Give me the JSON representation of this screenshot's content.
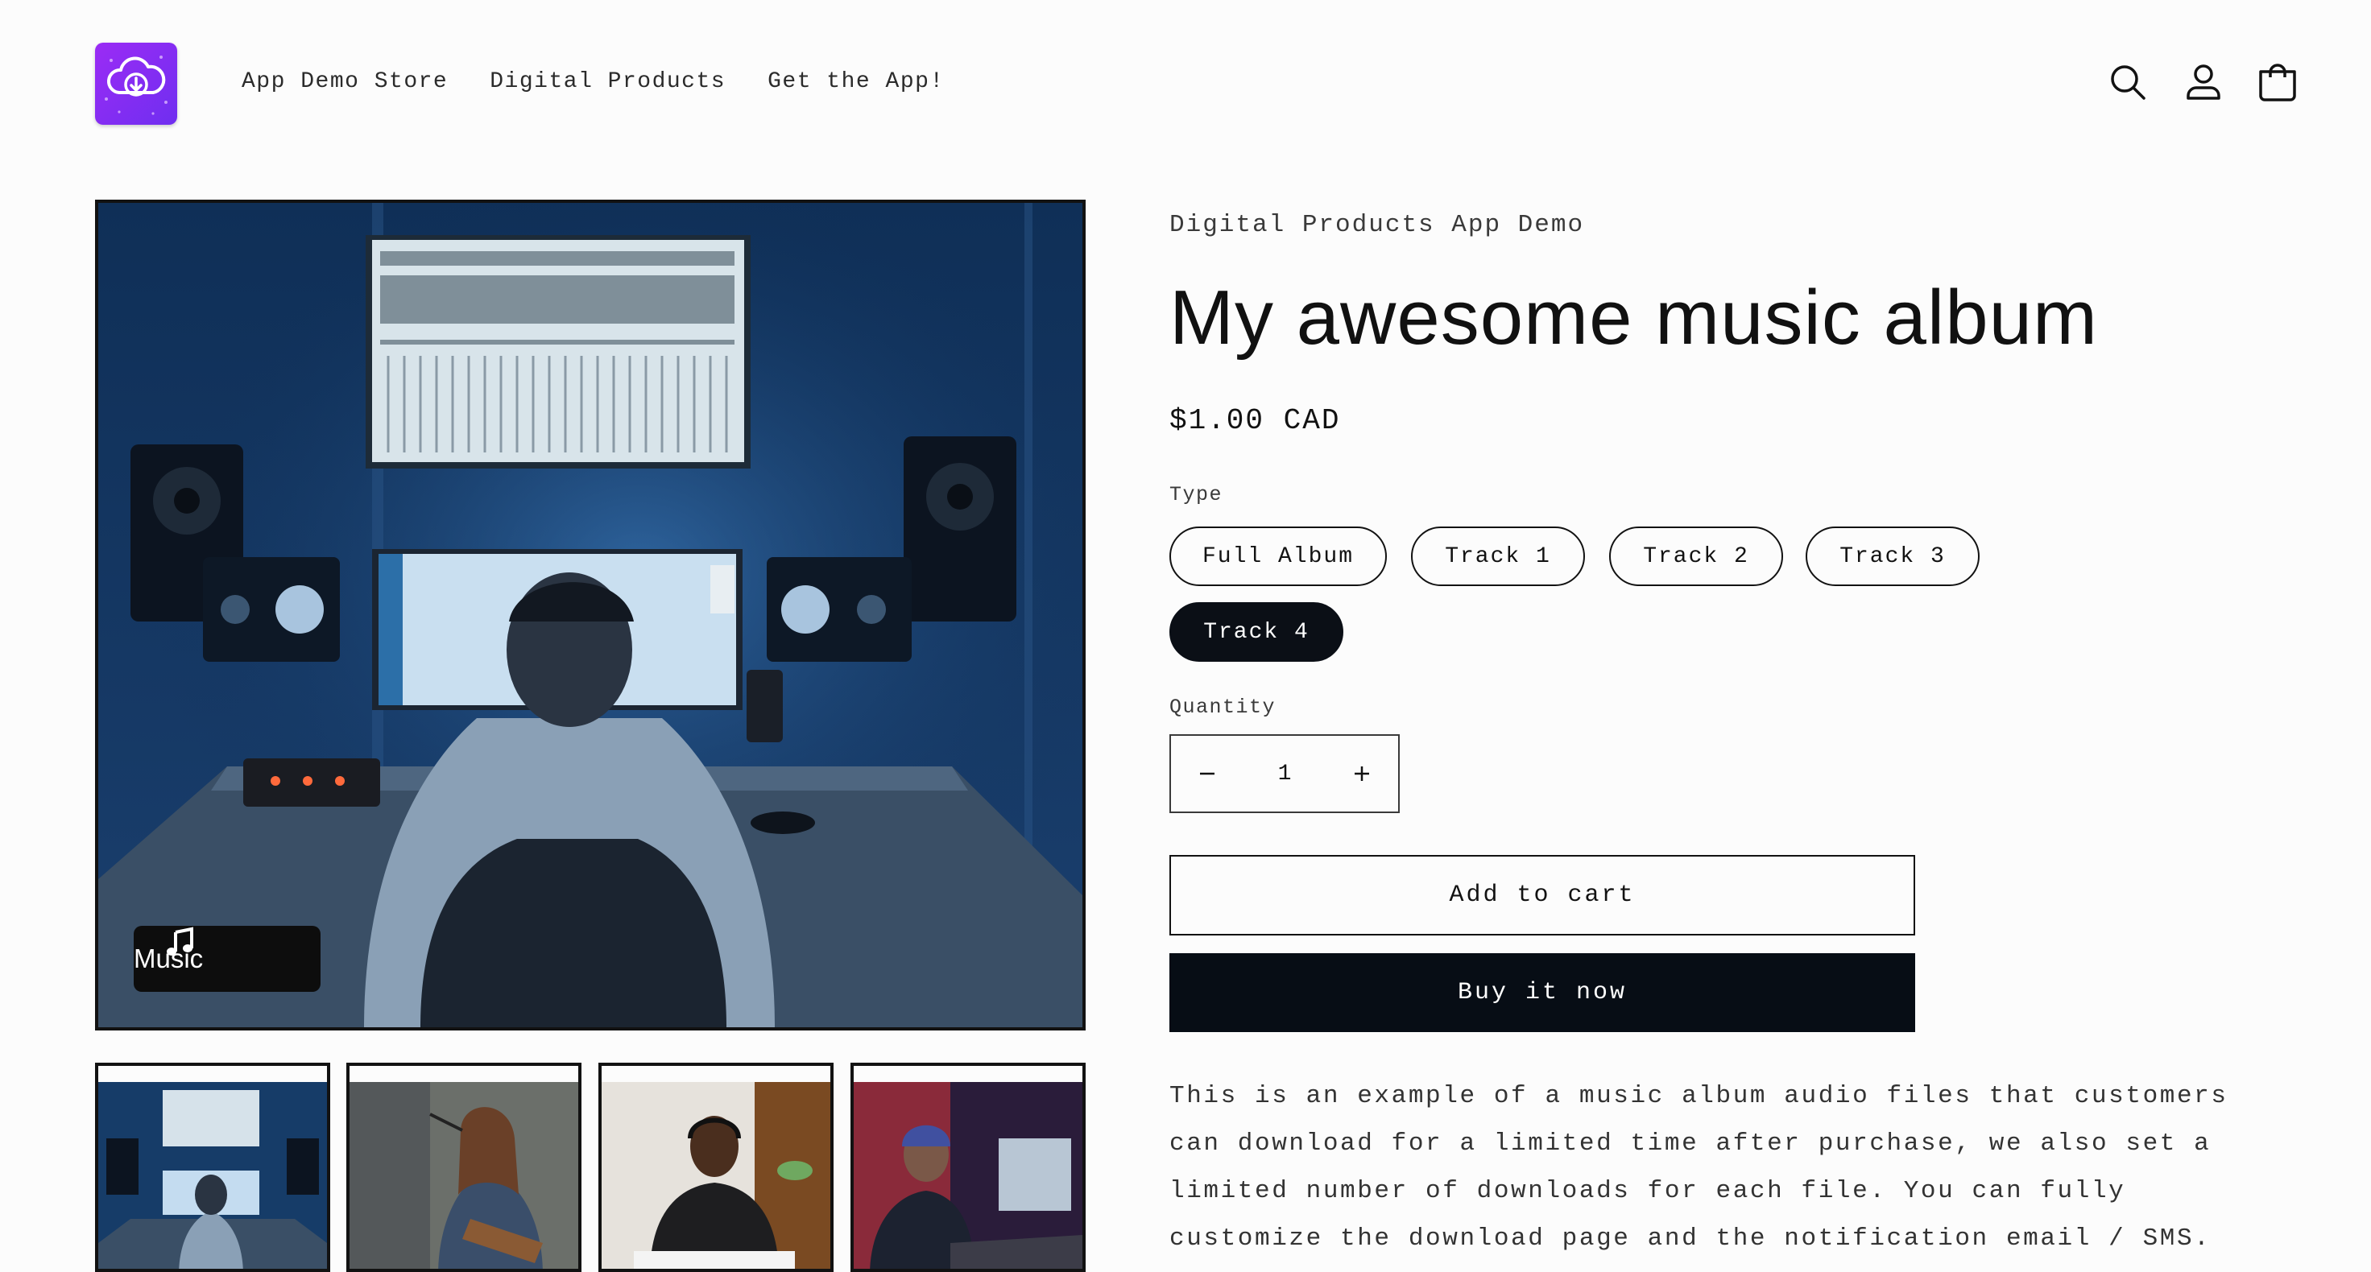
{
  "header": {
    "logo_alt": "App Demo Store logo",
    "nav": [
      "App Demo Store",
      "Digital Products",
      "Get the App!"
    ],
    "icons": [
      "search-icon",
      "account-icon",
      "cart-icon"
    ]
  },
  "gallery": {
    "badge_label": "Music",
    "thumbnails": [
      "studio-thumbnail",
      "singer-thumbnail",
      "pianist-thumbnail",
      "producer-thumbnail"
    ]
  },
  "product": {
    "vendor": "Digital Products App Demo",
    "title": "My awesome music album",
    "price": "$1.00 CAD",
    "type_label": "Type",
    "types": [
      "Full Album",
      "Track 1",
      "Track 2",
      "Track 3",
      "Track 4"
    ],
    "selected_type": "Track 4",
    "quantity_label": "Quantity",
    "quantity": "1",
    "add_to_cart": "Add to cart",
    "buy_now": "Buy it now",
    "description": "This is an example of a music album audio files that customers can download for a limited time after purchase, we also set a limited number of downloads for each file. You can fully customize the download page and the notification email / SMS."
  },
  "colors": {
    "accent": "#070d15",
    "logo_gradient_start": "#9b2cf5",
    "logo_gradient_end": "#6f2ef0",
    "background": "#fcfcfc"
  }
}
